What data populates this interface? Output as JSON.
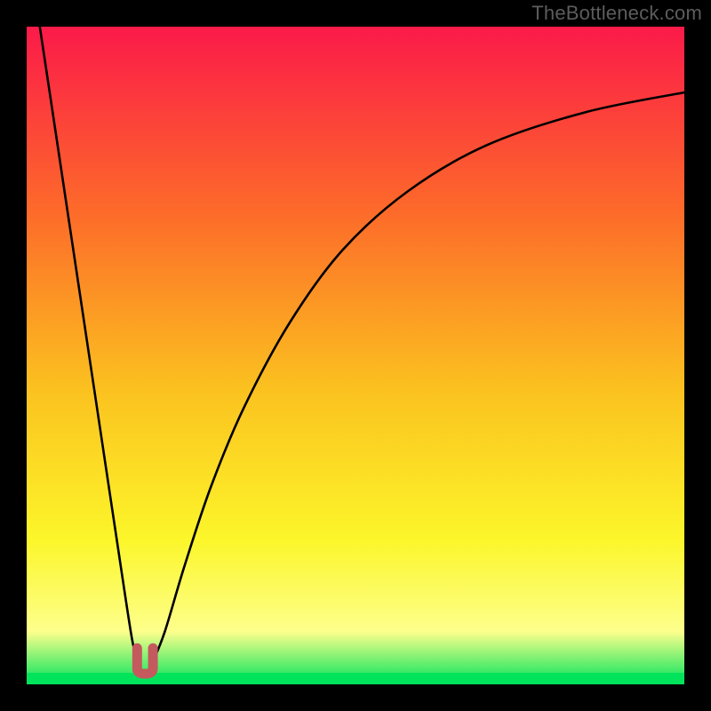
{
  "watermark": "TheBottleneck.com",
  "colors": {
    "frame": "#000000",
    "grad_top": "#fb1a49",
    "grad_mid1": "#fd6a2a",
    "grad_mid2": "#fbc11f",
    "grad_mid3": "#fcf62a",
    "grad_bottom_yellow": "#fdff8c",
    "grad_green": "#00e35b",
    "curve": "#000000",
    "marker_fill": "#c45a5d",
    "marker_stroke": "#c45a5d"
  },
  "chart_data": {
    "type": "line",
    "title": "",
    "xlabel": "",
    "ylabel": "",
    "xlim": [
      0,
      100
    ],
    "ylim": [
      0,
      100
    ],
    "grid": false,
    "legend": false,
    "description": "Bottleneck-style deviation curve: two branches rising from a near-zero minimum around x≈18 toward high values; left branch very steep, right branch rises more gradually and flattens toward the right edge. A small U-shaped marker highlights the minimum.",
    "series": [
      {
        "name": "left-branch",
        "x": [
          2,
          5,
          8,
          11,
          14,
          16,
          17
        ],
        "values": [
          100,
          80,
          60,
          40,
          20,
          7,
          3
        ]
      },
      {
        "name": "right-branch",
        "x": [
          19,
          21,
          24,
          28,
          33,
          40,
          48,
          58,
          70,
          85,
          100
        ],
        "values": [
          3,
          8,
          18,
          30,
          42,
          55,
          66,
          75,
          82,
          87,
          90
        ]
      }
    ],
    "minimum_marker": {
      "x_left": 16.8,
      "x_right": 19.2,
      "y_top": 5.5,
      "y_bottom": 1.6
    }
  }
}
